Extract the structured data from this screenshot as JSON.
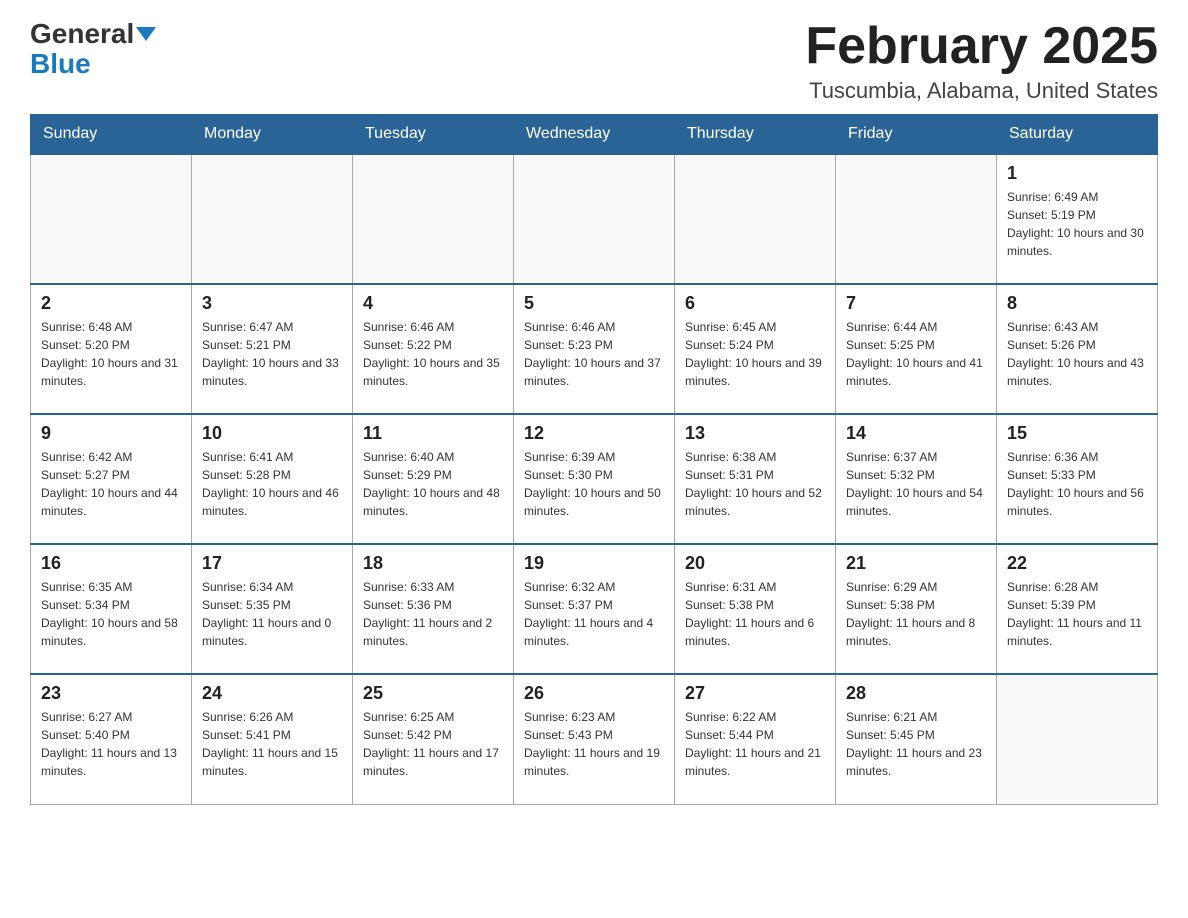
{
  "header": {
    "logo_general": "General",
    "logo_blue": "Blue",
    "month_title": "February 2025",
    "location": "Tuscumbia, Alabama, United States"
  },
  "days_of_week": [
    "Sunday",
    "Monday",
    "Tuesday",
    "Wednesday",
    "Thursday",
    "Friday",
    "Saturday"
  ],
  "weeks": [
    [
      {
        "day": "",
        "info": ""
      },
      {
        "day": "",
        "info": ""
      },
      {
        "day": "",
        "info": ""
      },
      {
        "day": "",
        "info": ""
      },
      {
        "day": "",
        "info": ""
      },
      {
        "day": "",
        "info": ""
      },
      {
        "day": "1",
        "info": "Sunrise: 6:49 AM\nSunset: 5:19 PM\nDaylight: 10 hours and 30 minutes."
      }
    ],
    [
      {
        "day": "2",
        "info": "Sunrise: 6:48 AM\nSunset: 5:20 PM\nDaylight: 10 hours and 31 minutes."
      },
      {
        "day": "3",
        "info": "Sunrise: 6:47 AM\nSunset: 5:21 PM\nDaylight: 10 hours and 33 minutes."
      },
      {
        "day": "4",
        "info": "Sunrise: 6:46 AM\nSunset: 5:22 PM\nDaylight: 10 hours and 35 minutes."
      },
      {
        "day": "5",
        "info": "Sunrise: 6:46 AM\nSunset: 5:23 PM\nDaylight: 10 hours and 37 minutes."
      },
      {
        "day": "6",
        "info": "Sunrise: 6:45 AM\nSunset: 5:24 PM\nDaylight: 10 hours and 39 minutes."
      },
      {
        "day": "7",
        "info": "Sunrise: 6:44 AM\nSunset: 5:25 PM\nDaylight: 10 hours and 41 minutes."
      },
      {
        "day": "8",
        "info": "Sunrise: 6:43 AM\nSunset: 5:26 PM\nDaylight: 10 hours and 43 minutes."
      }
    ],
    [
      {
        "day": "9",
        "info": "Sunrise: 6:42 AM\nSunset: 5:27 PM\nDaylight: 10 hours and 44 minutes."
      },
      {
        "day": "10",
        "info": "Sunrise: 6:41 AM\nSunset: 5:28 PM\nDaylight: 10 hours and 46 minutes."
      },
      {
        "day": "11",
        "info": "Sunrise: 6:40 AM\nSunset: 5:29 PM\nDaylight: 10 hours and 48 minutes."
      },
      {
        "day": "12",
        "info": "Sunrise: 6:39 AM\nSunset: 5:30 PM\nDaylight: 10 hours and 50 minutes."
      },
      {
        "day": "13",
        "info": "Sunrise: 6:38 AM\nSunset: 5:31 PM\nDaylight: 10 hours and 52 minutes."
      },
      {
        "day": "14",
        "info": "Sunrise: 6:37 AM\nSunset: 5:32 PM\nDaylight: 10 hours and 54 minutes."
      },
      {
        "day": "15",
        "info": "Sunrise: 6:36 AM\nSunset: 5:33 PM\nDaylight: 10 hours and 56 minutes."
      }
    ],
    [
      {
        "day": "16",
        "info": "Sunrise: 6:35 AM\nSunset: 5:34 PM\nDaylight: 10 hours and 58 minutes."
      },
      {
        "day": "17",
        "info": "Sunrise: 6:34 AM\nSunset: 5:35 PM\nDaylight: 11 hours and 0 minutes."
      },
      {
        "day": "18",
        "info": "Sunrise: 6:33 AM\nSunset: 5:36 PM\nDaylight: 11 hours and 2 minutes."
      },
      {
        "day": "19",
        "info": "Sunrise: 6:32 AM\nSunset: 5:37 PM\nDaylight: 11 hours and 4 minutes."
      },
      {
        "day": "20",
        "info": "Sunrise: 6:31 AM\nSunset: 5:38 PM\nDaylight: 11 hours and 6 minutes."
      },
      {
        "day": "21",
        "info": "Sunrise: 6:29 AM\nSunset: 5:38 PM\nDaylight: 11 hours and 8 minutes."
      },
      {
        "day": "22",
        "info": "Sunrise: 6:28 AM\nSunset: 5:39 PM\nDaylight: 11 hours and 11 minutes."
      }
    ],
    [
      {
        "day": "23",
        "info": "Sunrise: 6:27 AM\nSunset: 5:40 PM\nDaylight: 11 hours and 13 minutes."
      },
      {
        "day": "24",
        "info": "Sunrise: 6:26 AM\nSunset: 5:41 PM\nDaylight: 11 hours and 15 minutes."
      },
      {
        "day": "25",
        "info": "Sunrise: 6:25 AM\nSunset: 5:42 PM\nDaylight: 11 hours and 17 minutes."
      },
      {
        "day": "26",
        "info": "Sunrise: 6:23 AM\nSunset: 5:43 PM\nDaylight: 11 hours and 19 minutes."
      },
      {
        "day": "27",
        "info": "Sunrise: 6:22 AM\nSunset: 5:44 PM\nDaylight: 11 hours and 21 minutes."
      },
      {
        "day": "28",
        "info": "Sunrise: 6:21 AM\nSunset: 5:45 PM\nDaylight: 11 hours and 23 minutes."
      },
      {
        "day": "",
        "info": ""
      }
    ]
  ]
}
